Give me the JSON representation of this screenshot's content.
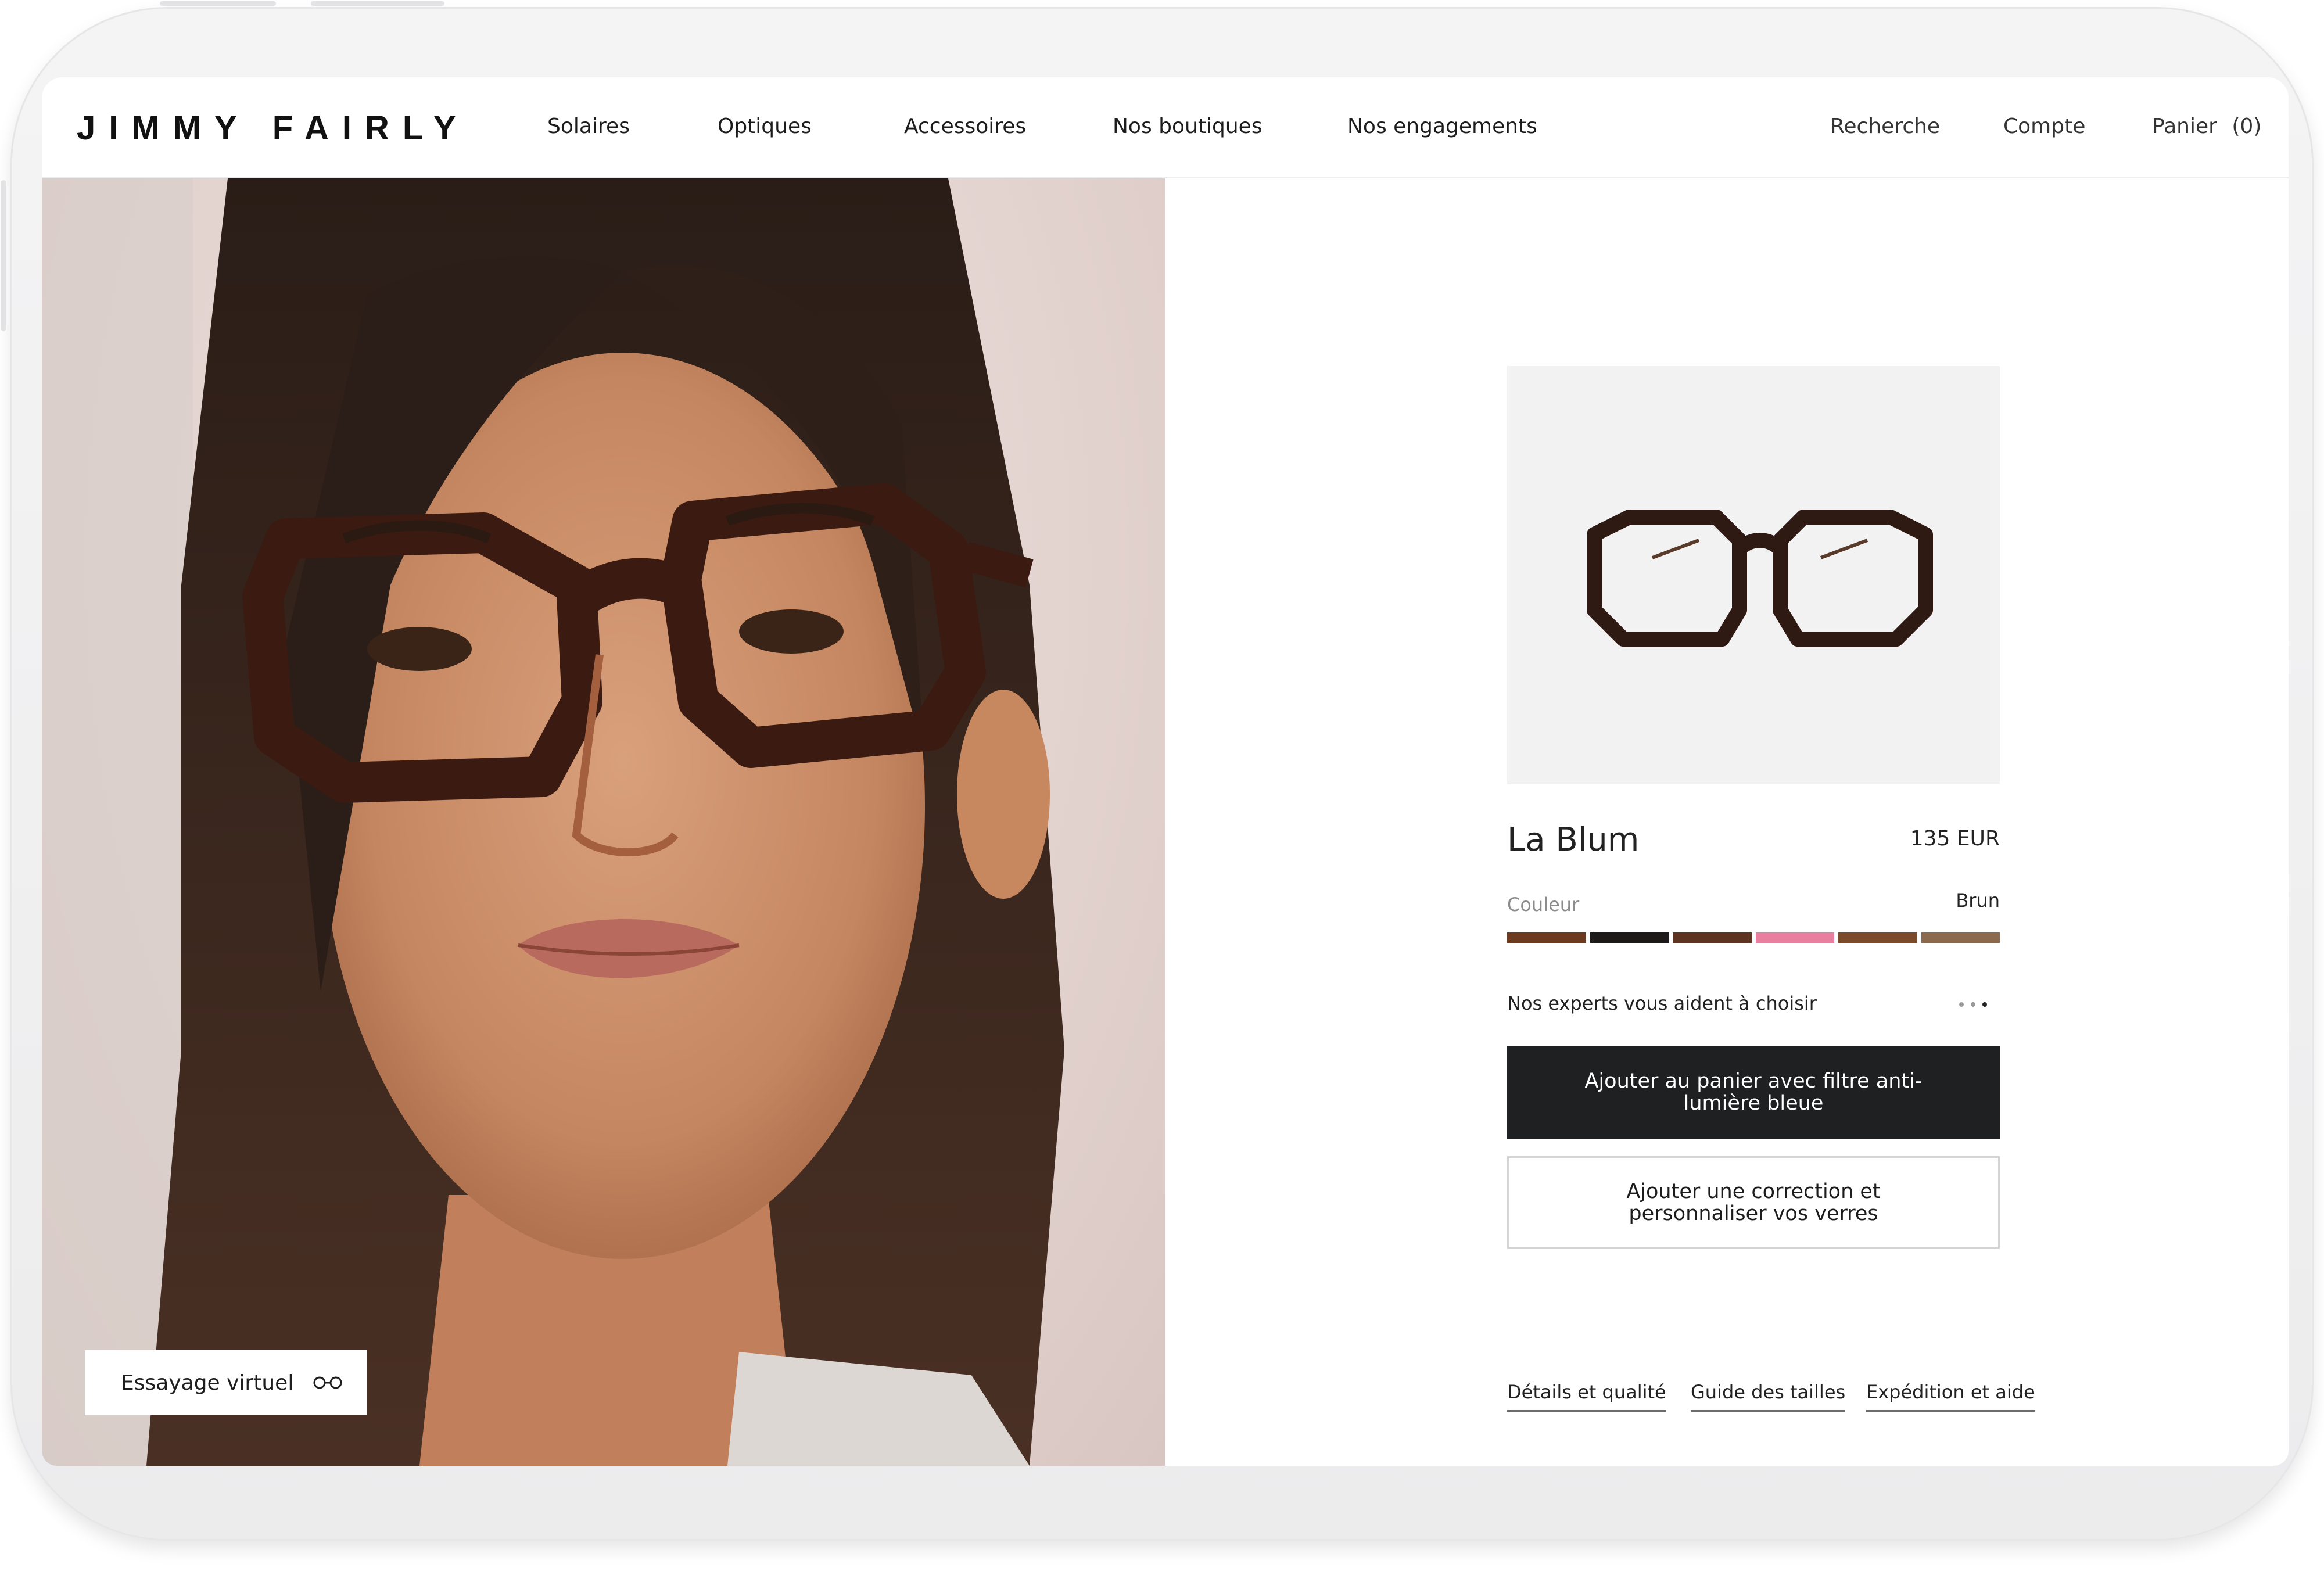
{
  "brand": {
    "logo_text": "JIMMY FAIRLY"
  },
  "nav": {
    "items": [
      {
        "label": "Solaires"
      },
      {
        "label": "Optiques"
      },
      {
        "label": "Accessoires"
      },
      {
        "label": "Nos boutiques"
      },
      {
        "label": "Nos engagements"
      }
    ],
    "search_label": "Recherche",
    "account_label": "Compte",
    "cart_label": "Panier",
    "cart_count": "(0)"
  },
  "hero": {
    "tryon_label": "Essayage virtuel",
    "tryon_icon": "glasses-icon"
  },
  "product": {
    "name": "La Blum",
    "price": "135 EUR",
    "color_label": "Couleur",
    "color_value": "Brun",
    "swatches": [
      "#6b3a1f",
      "#1d1a19",
      "#5e3220",
      "#e97fa0",
      "#7a4a2a",
      "#8b6a4e"
    ],
    "experts_text": "Nos experts vous aident à choisir",
    "primary_cta": "Ajouter au panier avec filtre anti-lumière bleue",
    "secondary_cta": "Ajouter une correction et personnaliser vos verres"
  },
  "footer_links": [
    "Détails et qualité",
    "Guide des tailles",
    "Expédition et aide"
  ]
}
